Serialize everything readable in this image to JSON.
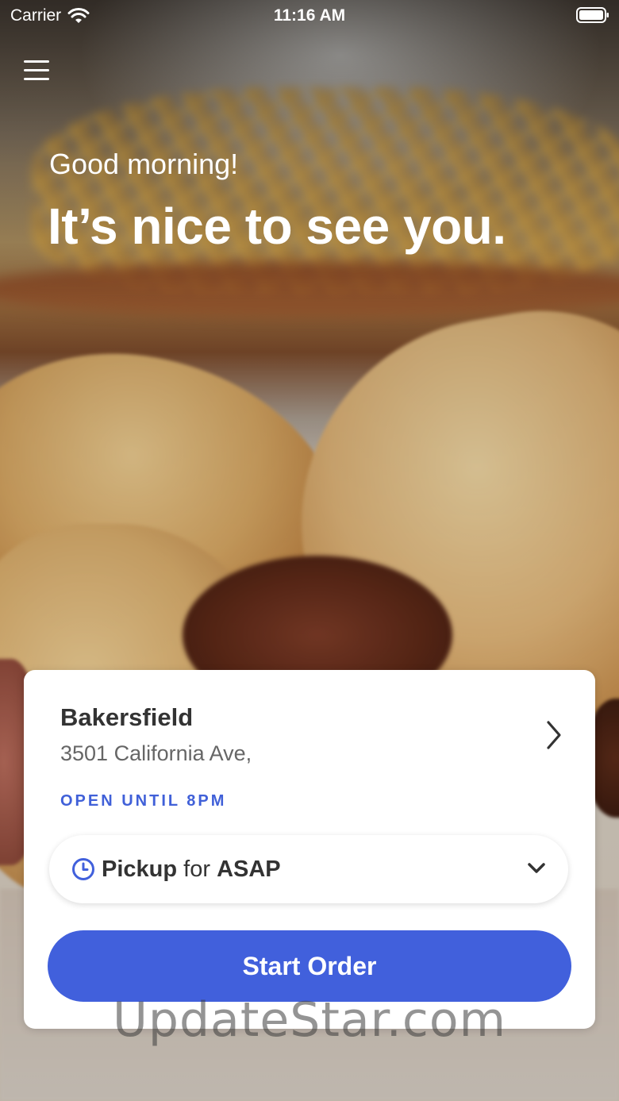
{
  "status_bar": {
    "carrier": "Carrier",
    "time": "11:16 AM"
  },
  "header": {
    "greeting": "Good morning!",
    "headline": "It’s nice to see you."
  },
  "location_card": {
    "name": "Bakersfield",
    "address": "3501 California Ave,",
    "hours": "OPEN UNTIL 8PM",
    "order_mode": {
      "mode": "Pickup",
      "connector": "for",
      "time": "ASAP"
    },
    "start_order_label": "Start Order"
  },
  "watermark": "UpdateStar.com",
  "colors": {
    "accent": "#4160dc",
    "status_text": "#4060d8"
  },
  "icons": [
    "wifi-icon",
    "battery-icon",
    "menu-icon",
    "chevron-right-icon",
    "clock-icon",
    "chevron-down-icon"
  ]
}
